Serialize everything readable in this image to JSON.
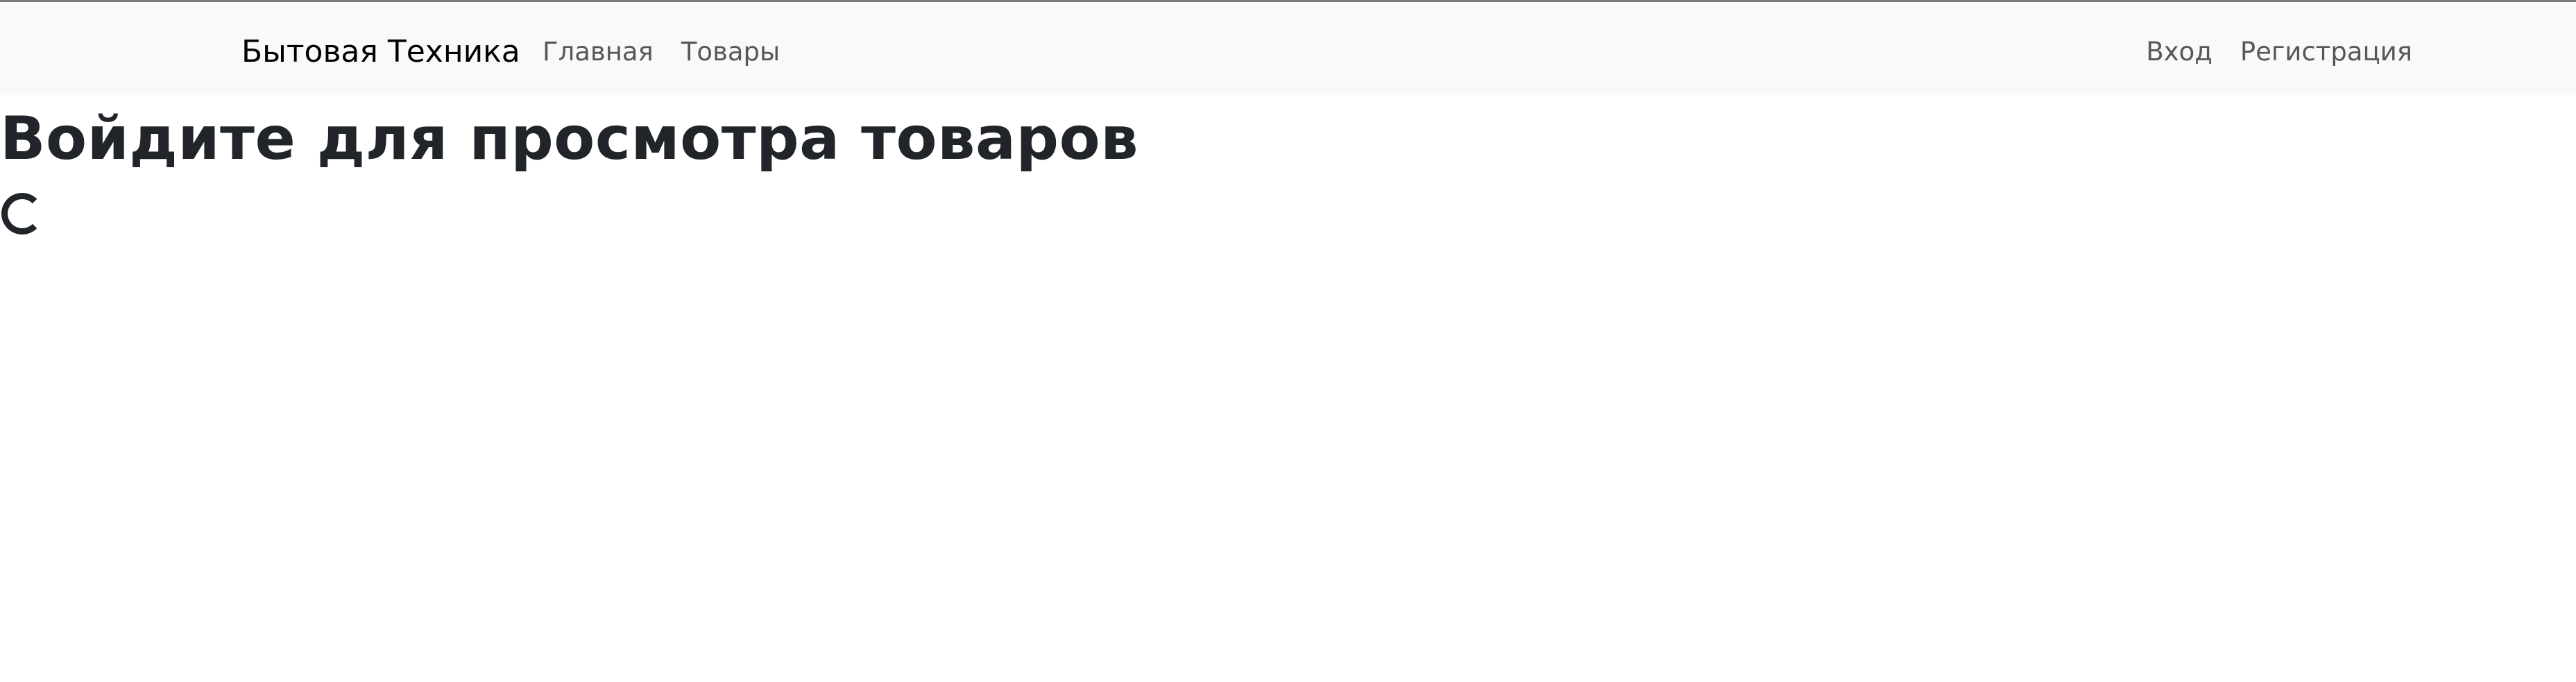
{
  "navbar": {
    "brand": "Бытовая Техника",
    "left_links": [
      {
        "label": "Главная"
      },
      {
        "label": "Товары"
      }
    ],
    "right_links": [
      {
        "label": "Вход"
      },
      {
        "label": "Регистрация"
      }
    ]
  },
  "main": {
    "heading": "Войдите для просмотра товаров",
    "loading_indicator": "spinner-icon"
  },
  "colors": {
    "navbar_background": "#f8f9fa",
    "text": "#212529",
    "nav_link": "#595959",
    "top_border": "#7a7a7a"
  }
}
